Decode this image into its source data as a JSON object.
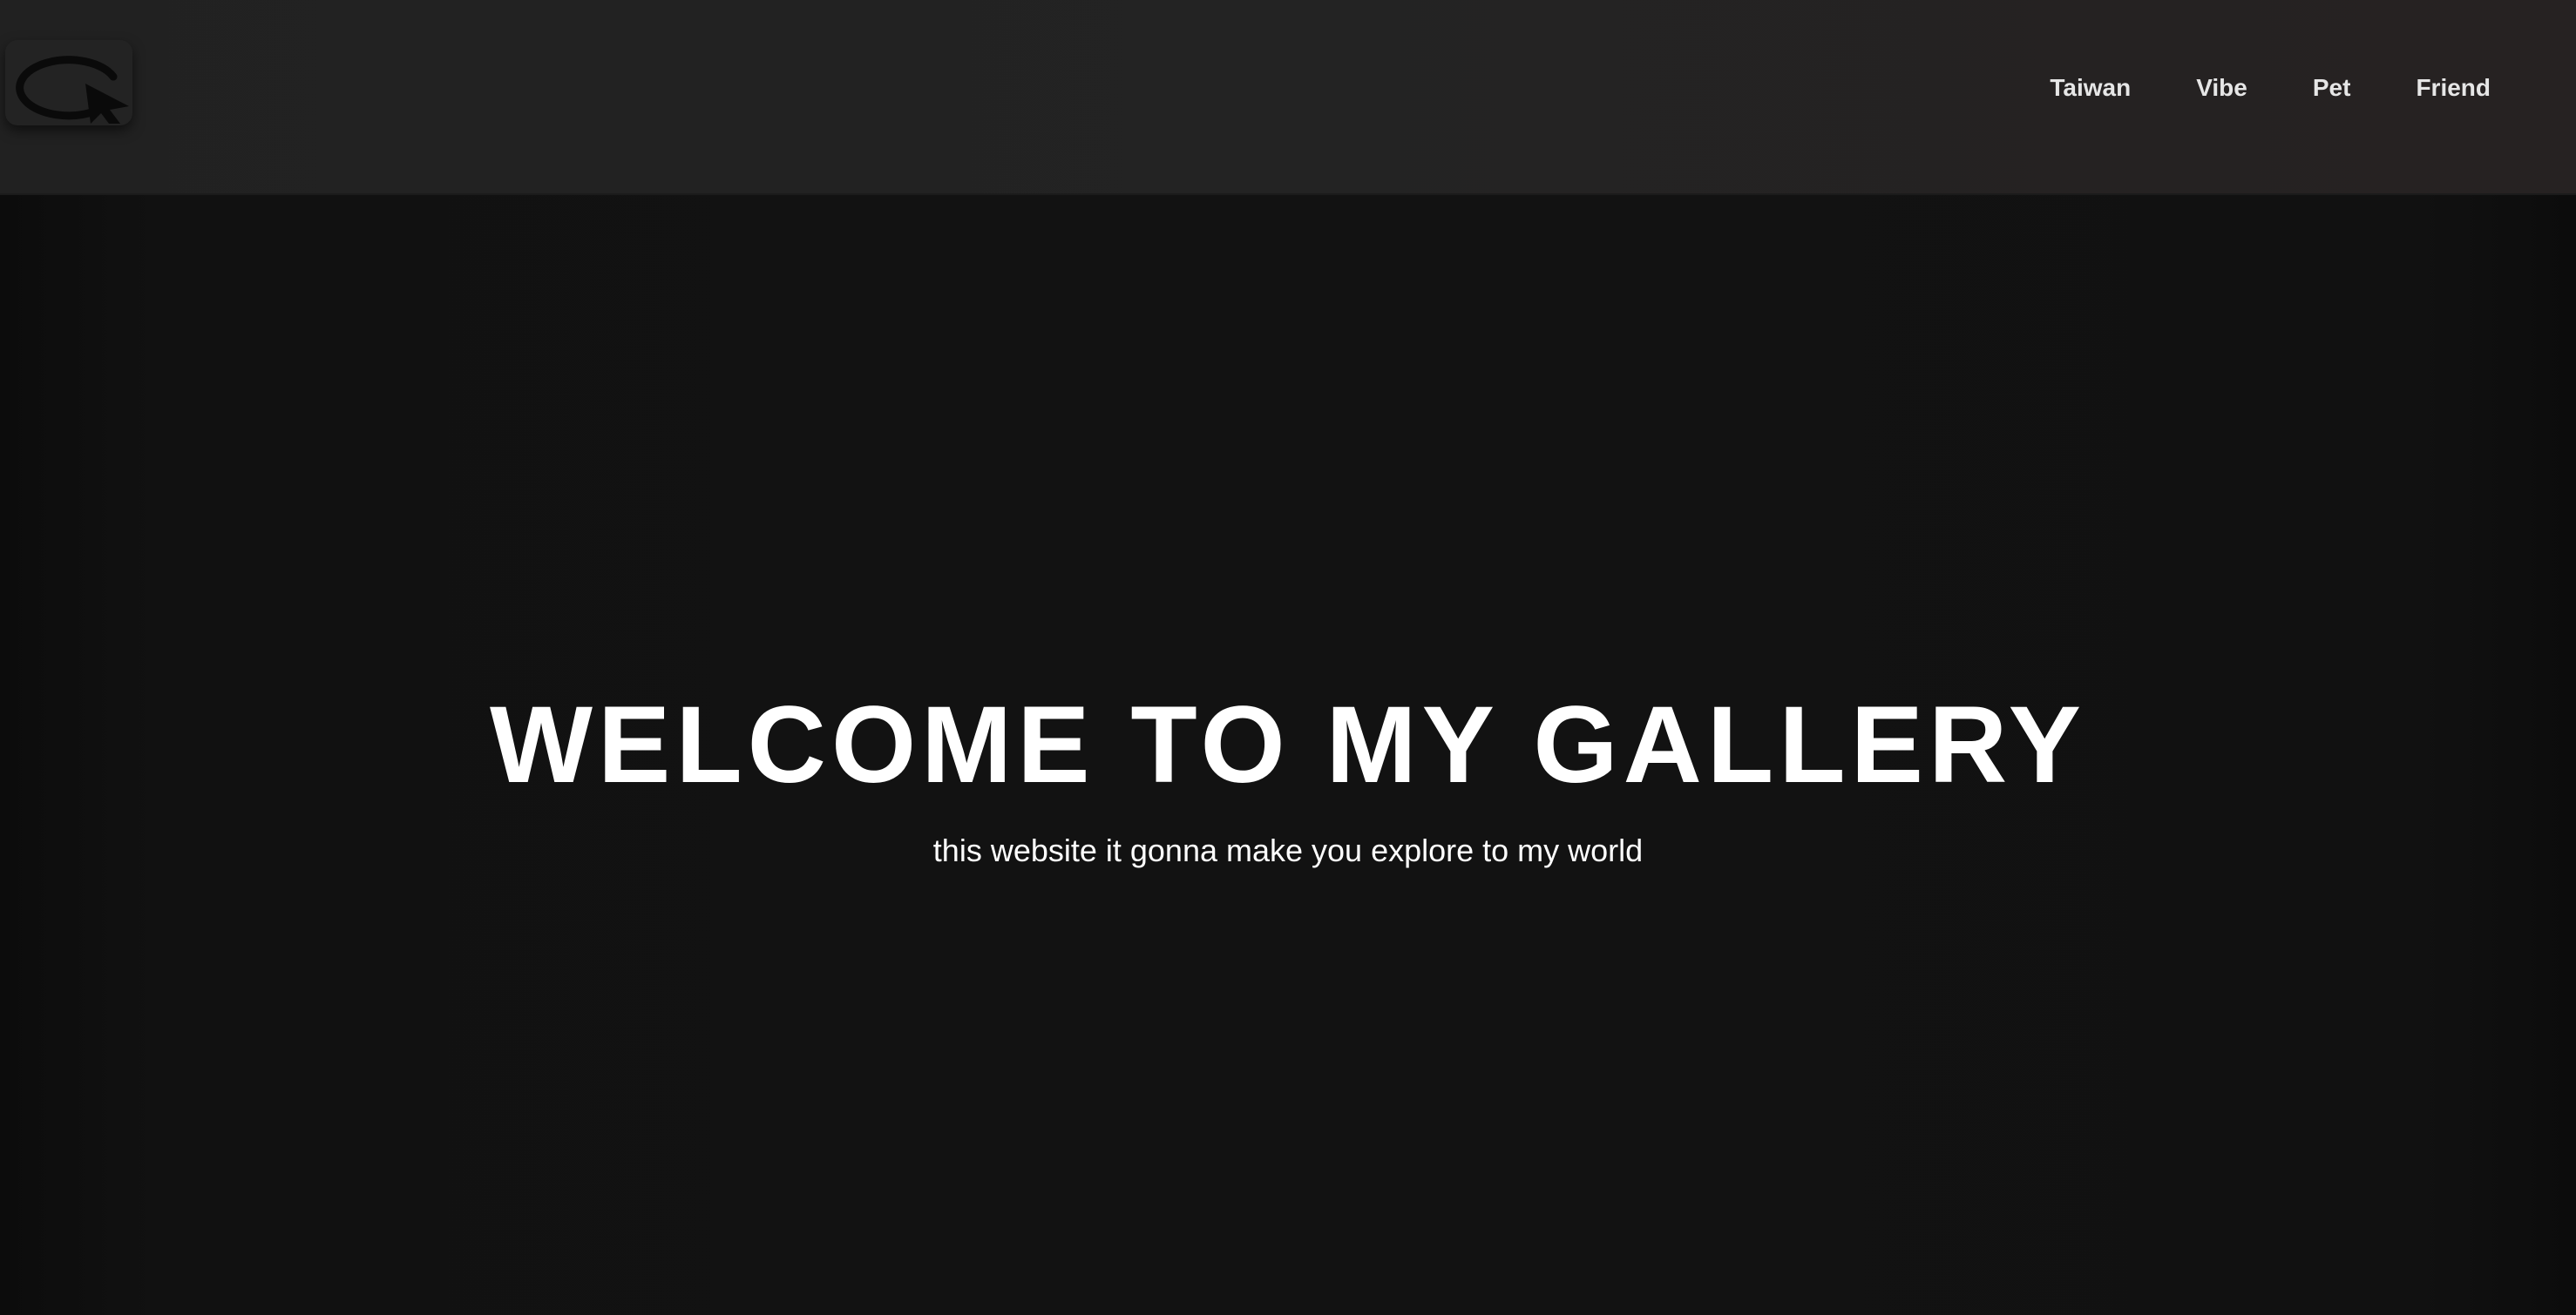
{
  "navbar": {
    "logo_icon": "refresh-cursor-icon",
    "links": [
      {
        "label": "Taiwan"
      },
      {
        "label": "Vibe"
      },
      {
        "label": "Pet"
      },
      {
        "label": "Friend"
      }
    ]
  },
  "hero": {
    "title": "WELCOME TO MY GALLERY",
    "subtitle": "this website it gonna make you explore to my world"
  },
  "colors": {
    "background": "#111111",
    "navbar": "#232323",
    "text": "#ffffff",
    "nav_text": "#e6e6e6"
  }
}
